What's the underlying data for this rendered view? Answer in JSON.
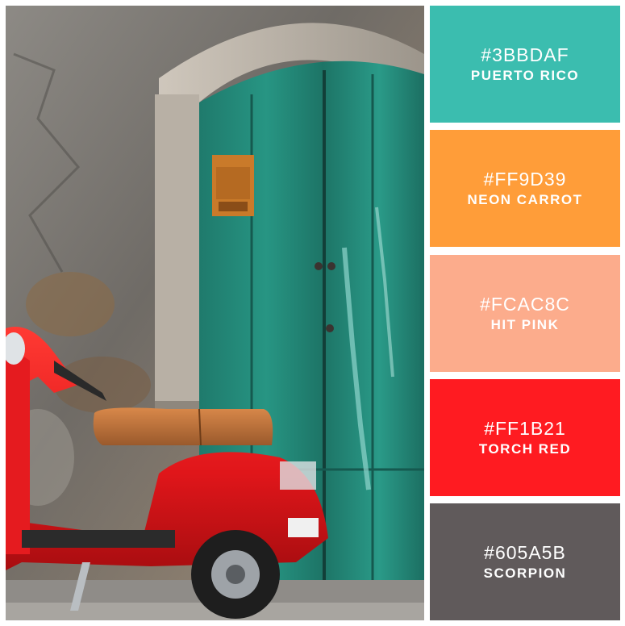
{
  "palette": [
    {
      "hex": "#3BBDAF",
      "name": "PUERTO RICO",
      "color": "#3BBDAF"
    },
    {
      "hex": "#FF9D39",
      "name": "NEON CARROT",
      "color": "#FF9D39"
    },
    {
      "hex": "#FCAC8C",
      "name": "HIT PINK",
      "color": "#FCAC8C"
    },
    {
      "hex": "#FF1B21",
      "name": "TORCH RED",
      "color": "#FF1B21"
    },
    {
      "hex": "#605A5B",
      "name": "SCORPION",
      "color": "#605A5B"
    }
  ],
  "photo": {
    "icon": "scooter-door-photo"
  }
}
